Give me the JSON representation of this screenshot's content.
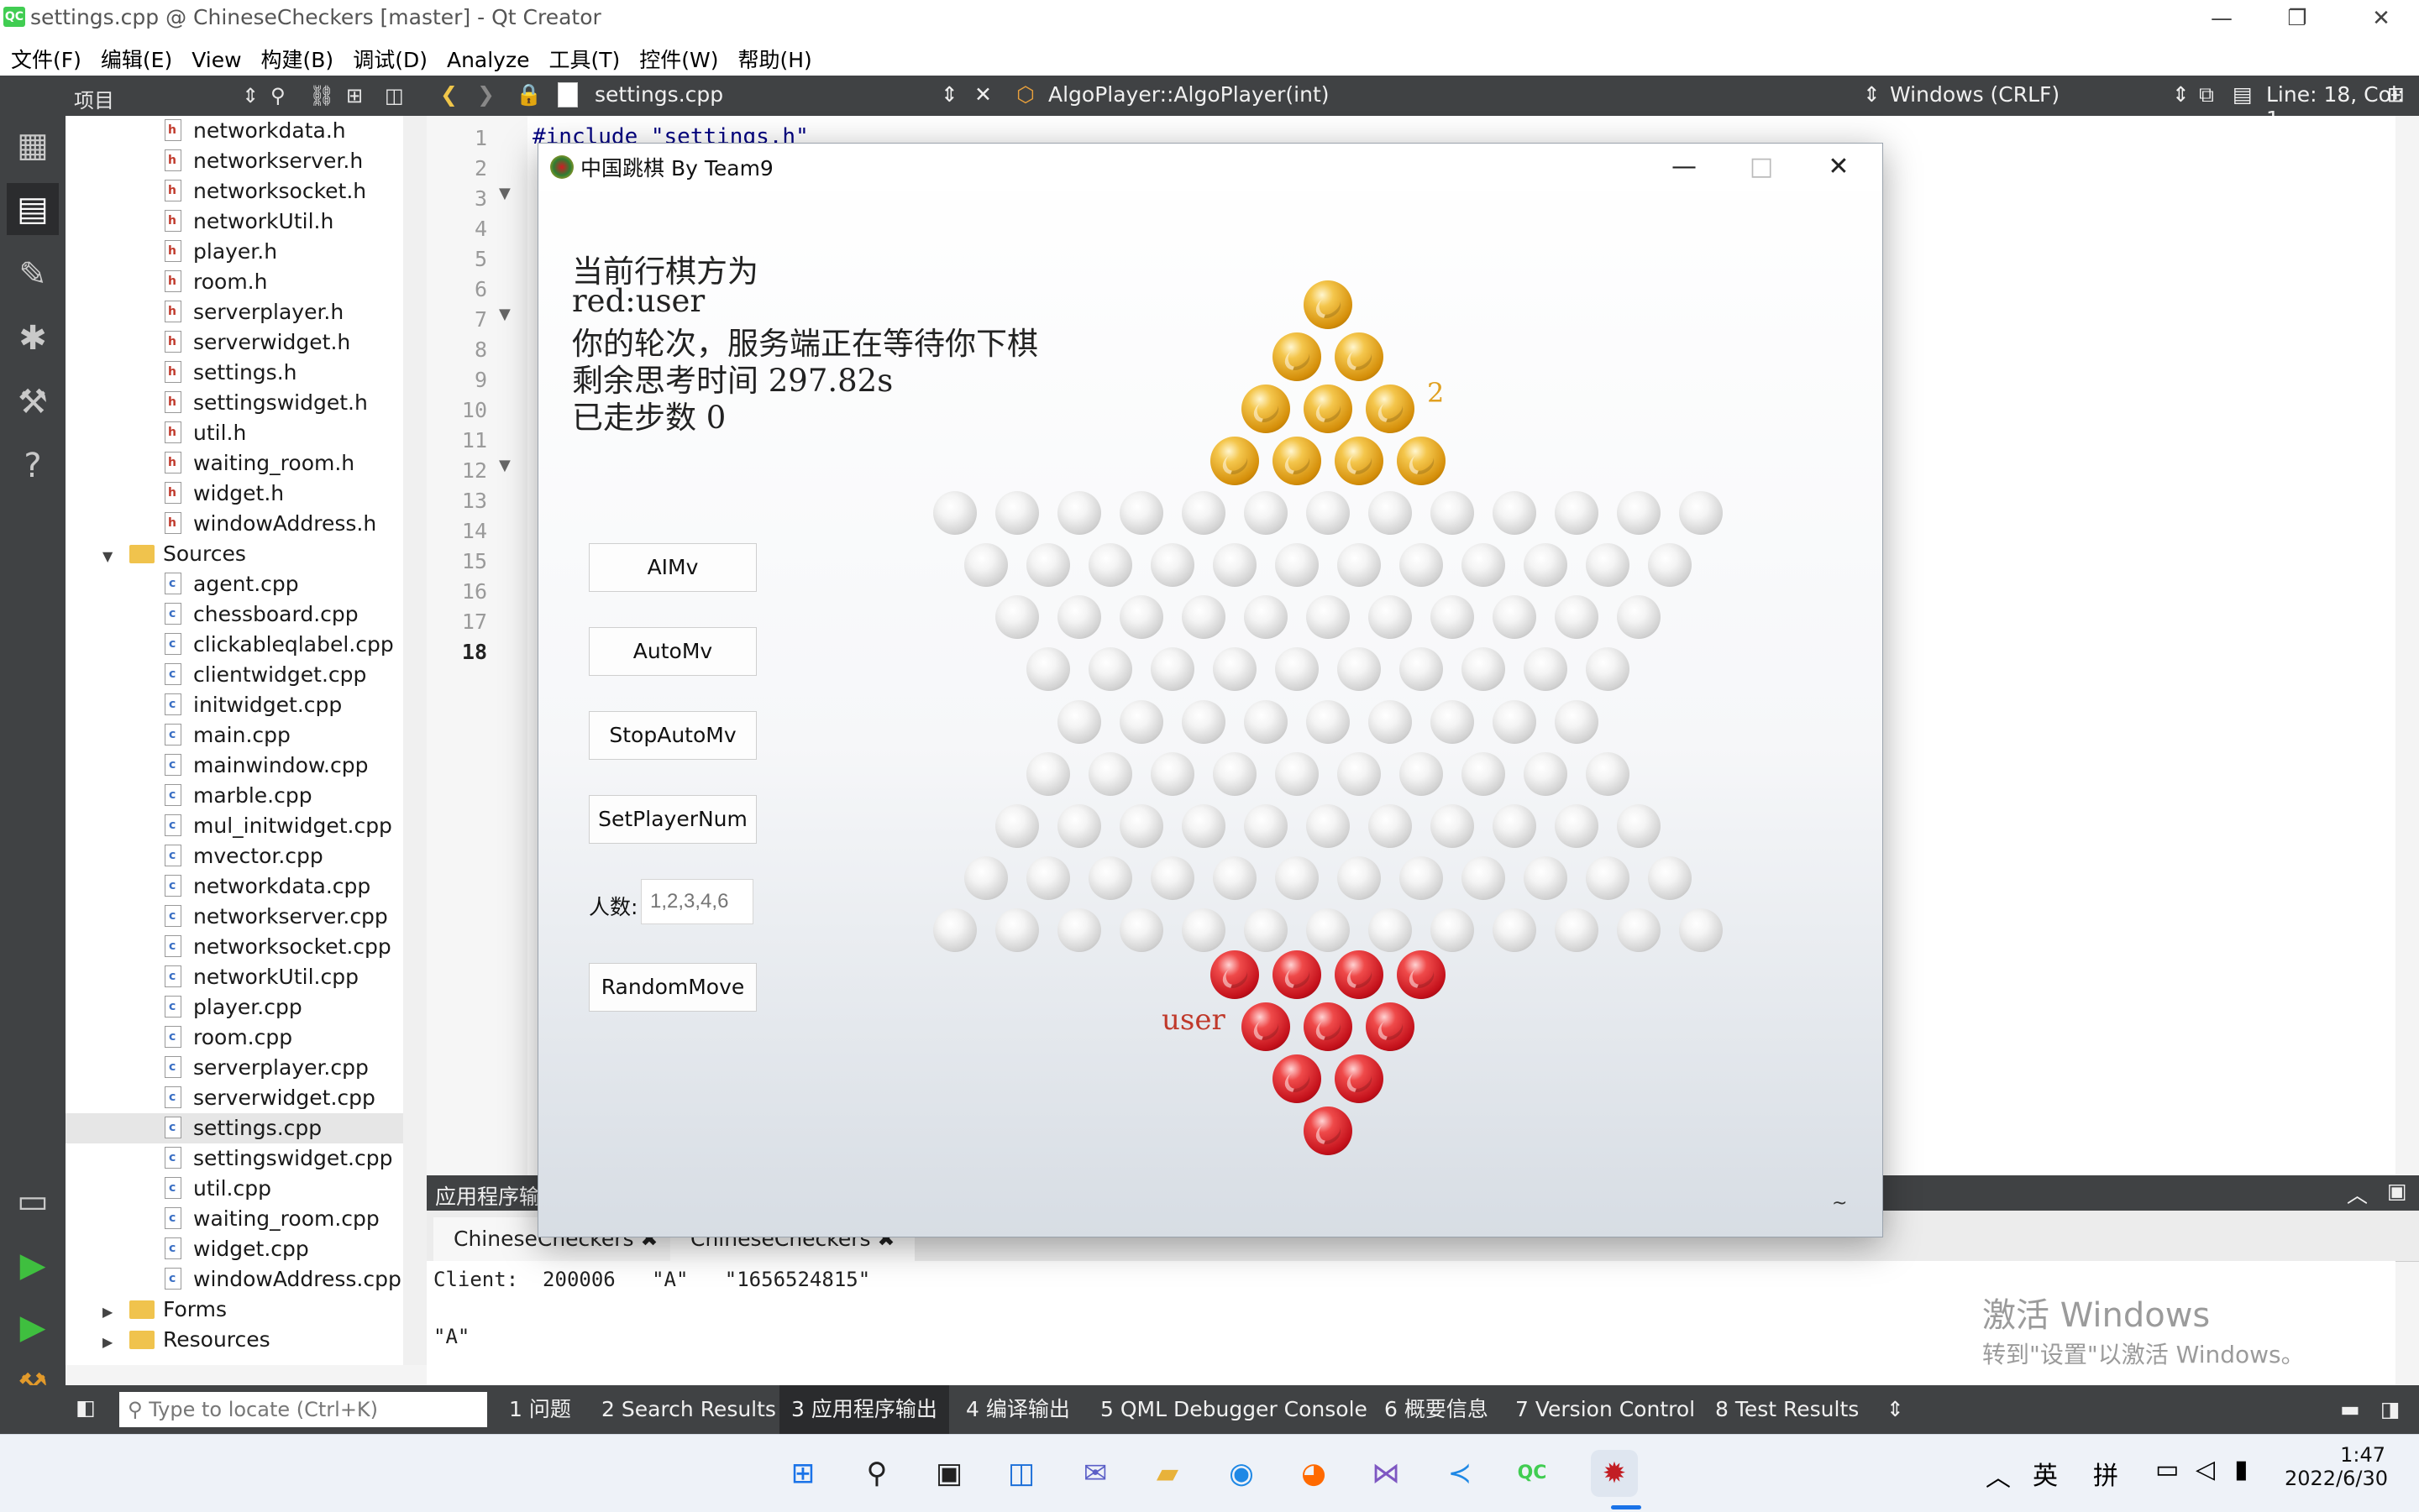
{
  "window": {
    "title": "settings.cpp @ ChineseCheckers [master] - Qt Creator",
    "app_icon": "qt-creator-icon"
  },
  "menu": [
    "文件(F)",
    "编辑(E)",
    "View",
    "构建(B)",
    "调试(D)",
    "Analyze",
    "工具(T)",
    "控件(W)",
    "帮助(H)"
  ],
  "project_pane": {
    "title": "项目",
    "headers_files": [
      "networkdata.h",
      "networkserver.h",
      "networksocket.h",
      "networkUtil.h",
      "player.h",
      "room.h",
      "serverplayer.h",
      "serverwidget.h",
      "settings.h",
      "settingswidget.h",
      "util.h",
      "waiting_room.h",
      "widget.h",
      "windowAddress.h"
    ],
    "sources_folder": "Sources",
    "source_files": [
      "agent.cpp",
      "chessboard.cpp",
      "clickableqlabel.cpp",
      "clientwidget.cpp",
      "initwidget.cpp",
      "main.cpp",
      "mainwindow.cpp",
      "marble.cpp",
      "mul_initwidget.cpp",
      "mvector.cpp",
      "networkdata.cpp",
      "networkserver.cpp",
      "networksocket.cpp",
      "networkUtil.cpp",
      "player.cpp",
      "room.cpp",
      "serverplayer.cpp",
      "serverwidget.cpp",
      "settings.cpp",
      "settingswidget.cpp",
      "util.cpp",
      "waiting_room.cpp",
      "widget.cpp",
      "windowAddress.cpp"
    ],
    "selected_file": "settings.cpp",
    "forms_folder": "Forms",
    "resources_folder": "Resources"
  },
  "editor": {
    "file_tab": "settings.cpp",
    "symbol": "AlgoPlayer::AlgoPlayer(int)",
    "line_ending": "Windows (CRLF)",
    "cursor": "Line: 18, Col: 1",
    "line_numbers": [
      "1",
      "2",
      "3",
      "4",
      "5",
      "6",
      "7",
      "8",
      "9",
      "10",
      "11",
      "12",
      "13",
      "14",
      "15",
      "16",
      "17",
      "18"
    ],
    "first_line_code": "#include \"settings.h\""
  },
  "output_pane": {
    "title": "应用程序输出",
    "tabs": [
      "ChineseCheckers",
      "ChineseCheckers"
    ],
    "lines": [
      "Client:  200006   \"A\"   \"1656524815\"",
      "",
      "\"A\""
    ],
    "watermark_line1": "激活 Windows",
    "watermark_line2": "转到\"设置\"以激活 Windows。"
  },
  "statusbar": {
    "locate_placeholder": "Type to locate (Ctrl+K)",
    "tabs": [
      "1  问题",
      "2  Search Results",
      "3  应用程序输出",
      "4  编译输出",
      "5  QML Debugger Console",
      "6  概要信息",
      "7  Version Control",
      "8  Test Results"
    ]
  },
  "game": {
    "title": "中国跳棋 By Team9",
    "info_lines": [
      "当前行棋方为",
      "red:user",
      "你的轮次，服务端正在等待你下棋",
      "剩余思考时间 297.82s",
      "已走步数 0"
    ],
    "buttons": [
      "AIMv",
      "AutoMv",
      "StopAutoMv",
      "SetPlayerNum"
    ],
    "player_num_label": "人数:",
    "player_num_placeholder": "1,2,3,4,6",
    "random_button": "RandomMove",
    "top_player_label": "2",
    "bottom_player_label": "user",
    "corner_glyph": "~",
    "colors": {
      "top_pieces": "#e0a020",
      "bottom_pieces": "#d21a24",
      "top_label": "#e0a020",
      "bottom_label": "#c0392b"
    }
  },
  "taskbar": {
    "icons": [
      "windows-start-icon",
      "search-icon",
      "task-view-icon",
      "widgets-icon",
      "teams-chat-icon",
      "file-explorer-icon",
      "edge-icon",
      "firefox-icon",
      "visual-studio-icon",
      "vscode-icon",
      "qt-creator-icon",
      "chinese-checkers-icon"
    ],
    "tray": [
      "chevron-up-icon",
      "英",
      "拼",
      "network-icon",
      "volume-icon",
      "battery-icon"
    ],
    "time": "1:47",
    "date": "2022/6/30"
  }
}
